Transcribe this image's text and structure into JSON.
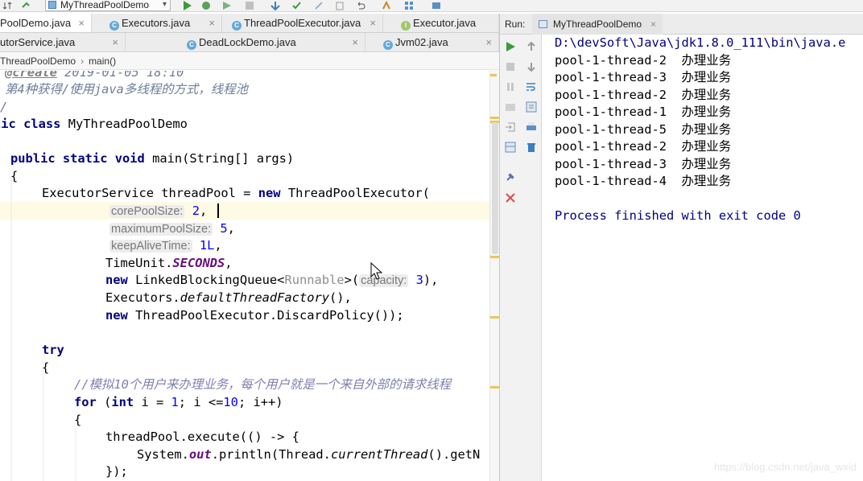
{
  "toolbar": {
    "run_config": "MyThreadPoolDemo"
  },
  "tabs_row1": [
    {
      "label": "PoolDemo.java",
      "active": true
    },
    {
      "label": "Executors.java",
      "icon": "class-icon"
    },
    {
      "label": "ThreadPoolExecutor.java",
      "icon": "class-icon"
    },
    {
      "label": "Executor.java",
      "icon": "interface-icon"
    }
  ],
  "tabs_row2": [
    {
      "label": "utorService.java"
    },
    {
      "label": "DeadLockDemo.java"
    },
    {
      "label": "Jvm02.java"
    }
  ],
  "breadcrumb": [
    "ThreadPoolDemo",
    "main()"
  ],
  "code": {
    "doc_tag": "@create",
    "doc_date": "2019-01-05 18:10",
    "doc_line": "第4种获得/使用java多线程的方式，线程池",
    "doc_end": "/",
    "class_kw": "lic class",
    "class_name": "MyThreadPoolDemo",
    "main_kw": "public static void",
    "main_sig": "main(String[] args)",
    "brace_open": "{",
    "exec_decl": "ExecutorService threadPool = ",
    "new_kw": "new",
    "exec_ctor": "ThreadPoolExecutor(",
    "hint_core": "corePoolSize:",
    "val_core": "2",
    "hint_max": "maximumPoolSize:",
    "val_max": "5",
    "hint_keep": "keepAliveTime:",
    "val_keep": "1L",
    "timeunit": "TimeUnit.",
    "seconds": "SECONDS",
    "queue_new": "new",
    "queue_cls": "LinkedBlockingQueue<",
    "queue_gen": "Runnable",
    "queue_close": ">(",
    "hint_cap": "capacity:",
    "val_cap": "3",
    "queue_end": "),",
    "executors": "Executors.",
    "factory": "defaultThreadFactory",
    "factory_end": "(),",
    "policy_new": "new",
    "policy": "ThreadPoolExecutor.DiscardPolicy());",
    "try_kw": "try",
    "comment_users": "//模拟10个用户来办理业务，每个用户就是一个来自外部的请求线程",
    "for_kw": "for",
    "for_open": " (",
    "int_kw": "int",
    "for_i": " i = ",
    "for_one": "1",
    "for_cond": "; i <=",
    "for_ten": "10",
    "for_end": "; i++)",
    "exec_call": "threadPool.execute(() -> {",
    "sys": "System.",
    "out": "out",
    "println": ".println(Thread.",
    "current": "currentThread",
    "getn": "().getN",
    "close_call": "});"
  },
  "run_panel": {
    "label": "Run:",
    "tab": "MyThreadPoolDemo",
    "console": [
      "D:\\devSoft\\Java\\jdk1.8.0_111\\bin\\java.e",
      "pool-1-thread-2  办理业务",
      "pool-1-thread-3  办理业务",
      "pool-1-thread-2  办理业务",
      "pool-1-thread-1  办理业务",
      "pool-1-thread-5  办理业务",
      "pool-1-thread-2  办理业务",
      "pool-1-thread-3  办理业务",
      "pool-1-thread-4  办理业务",
      "",
      "Process finished with exit code 0"
    ]
  },
  "watermark": "https://blog.csdn.net/java_wxid",
  "colors": {
    "keyword": "#000080",
    "field": "#660e7a",
    "number": "#0000ff",
    "run_green": "#3a9b3a",
    "stop_red": "#d9534f"
  }
}
